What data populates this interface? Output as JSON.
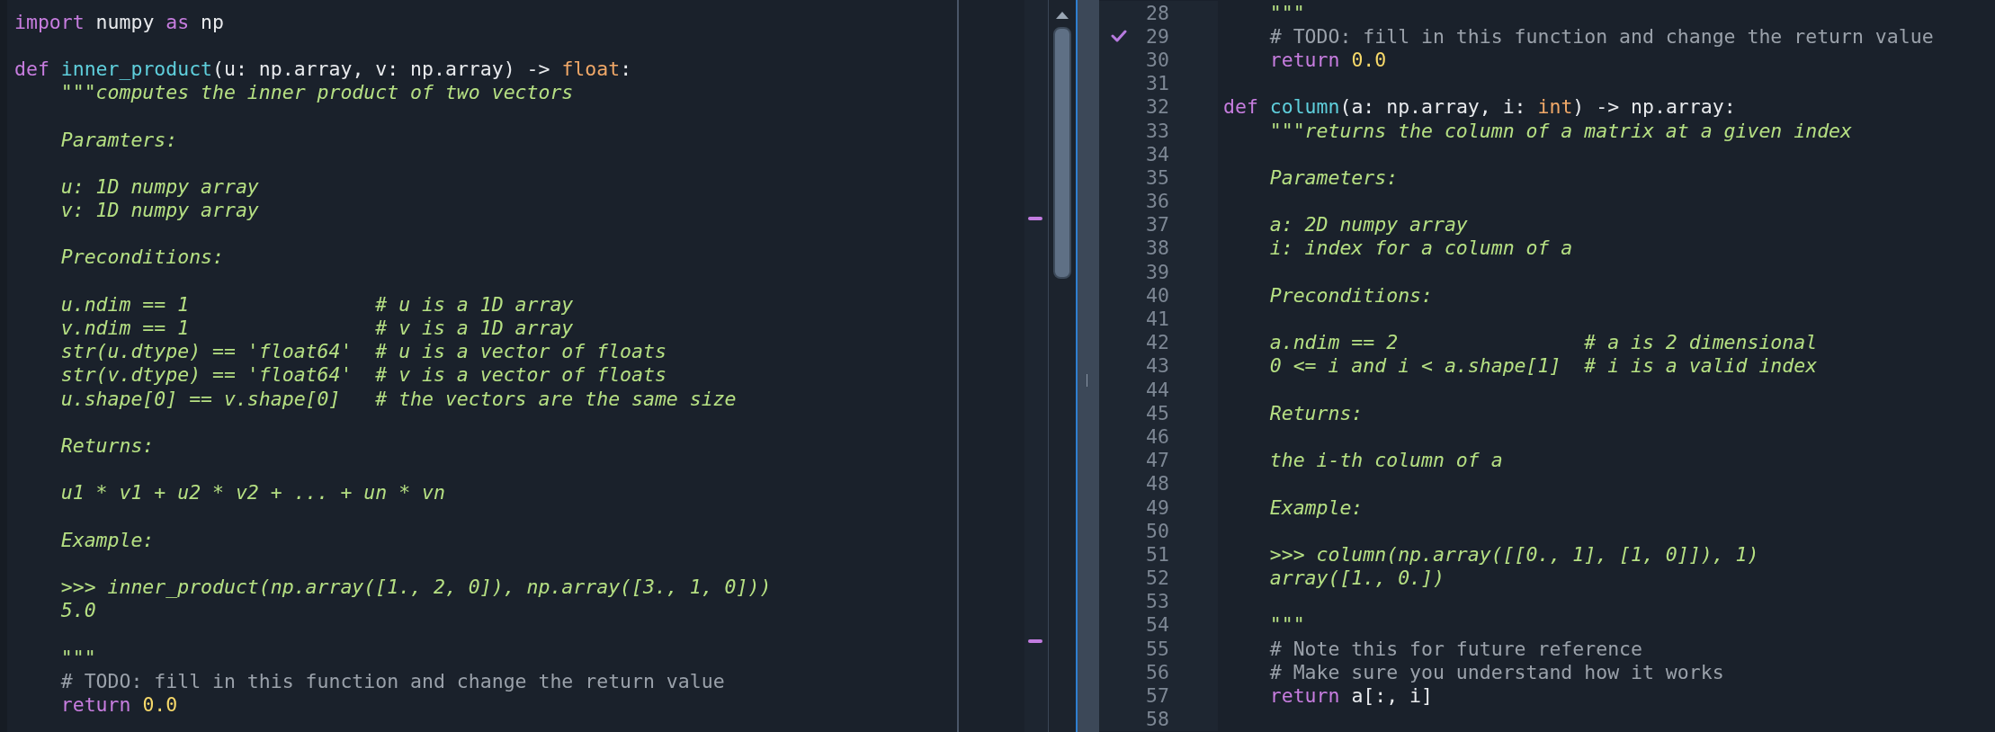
{
  "left_editor": {
    "lines": [
      {
        "kind": "code",
        "segments": [
          {
            "text": "import",
            "kind": "keyword"
          },
          {
            "text": " numpy ",
            "kind": "plain"
          },
          {
            "text": "as",
            "kind": "keyword"
          },
          {
            "text": " np",
            "kind": "plain"
          }
        ]
      },
      {
        "kind": "blank"
      },
      {
        "kind": "code",
        "segments": [
          {
            "text": "def ",
            "kind": "keyword"
          },
          {
            "text": "inner_product",
            "kind": "function"
          },
          {
            "text": "(u: np.array, v: np.array) -> ",
            "kind": "plain"
          },
          {
            "text": "float",
            "kind": "type"
          },
          {
            "text": ":",
            "kind": "plain"
          }
        ]
      },
      {
        "kind": "code",
        "segments": [
          {
            "text": "    \"\"\"computes the inner product of two vectors",
            "kind": "docstring"
          }
        ]
      },
      {
        "kind": "blank"
      },
      {
        "kind": "code",
        "segments": [
          {
            "text": "    Paramters:",
            "kind": "docstring"
          }
        ]
      },
      {
        "kind": "blank"
      },
      {
        "kind": "code",
        "segments": [
          {
            "text": "    u: 1D numpy array",
            "kind": "docstring"
          }
        ]
      },
      {
        "kind": "code",
        "segments": [
          {
            "text": "    v: 1D numpy array",
            "kind": "docstring"
          }
        ]
      },
      {
        "kind": "blank"
      },
      {
        "kind": "code",
        "segments": [
          {
            "text": "    Preconditions:",
            "kind": "docstring"
          }
        ]
      },
      {
        "kind": "blank"
      },
      {
        "kind": "code",
        "segments": [
          {
            "text": "    u.ndim == 1                # u is a 1D array",
            "kind": "docstring"
          }
        ]
      },
      {
        "kind": "code",
        "segments": [
          {
            "text": "    v.ndim == 1                # v is a 1D array",
            "kind": "docstring"
          }
        ]
      },
      {
        "kind": "code",
        "segments": [
          {
            "text": "    str(u.dtype) == 'float64'  # u is a vector of floats",
            "kind": "docstring"
          }
        ]
      },
      {
        "kind": "code",
        "segments": [
          {
            "text": "    str(v.dtype) == 'float64'  # v is a vector of floats",
            "kind": "docstring"
          }
        ]
      },
      {
        "kind": "code",
        "segments": [
          {
            "text": "    u.shape[0] == v.shape[0]   # the vectors are the same size",
            "kind": "docstring"
          }
        ]
      },
      {
        "kind": "blank"
      },
      {
        "kind": "code",
        "segments": [
          {
            "text": "    Returns:",
            "kind": "docstring"
          }
        ]
      },
      {
        "kind": "blank"
      },
      {
        "kind": "code",
        "segments": [
          {
            "text": "    u1 * v1 + u2 * v2 + ... + un * vn",
            "kind": "docstring"
          }
        ]
      },
      {
        "kind": "blank"
      },
      {
        "kind": "code",
        "segments": [
          {
            "text": "    Example:",
            "kind": "docstring"
          }
        ]
      },
      {
        "kind": "blank"
      },
      {
        "kind": "code",
        "segments": [
          {
            "text": "    >>> inner_product(np.array([1., 2, 0]), np.array([3., 1, 0]))",
            "kind": "docstring"
          }
        ]
      },
      {
        "kind": "code",
        "segments": [
          {
            "text": "    5.0",
            "kind": "docstring"
          }
        ]
      },
      {
        "kind": "blank"
      },
      {
        "kind": "code",
        "segments": [
          {
            "text": "    \"\"\"",
            "kind": "docstring"
          }
        ]
      },
      {
        "kind": "code",
        "segments": [
          {
            "text": "    # TODO: fill in this function and change the return value",
            "kind": "comment"
          }
        ]
      },
      {
        "kind": "code",
        "segments": [
          {
            "text": "    return ",
            "kind": "keyword"
          },
          {
            "text": "0.0",
            "kind": "number"
          }
        ]
      }
    ]
  },
  "right_editor": {
    "lines": [
      {
        "number": "28",
        "checked": false,
        "segments": [
          {
            "text": "    \"\"\"",
            "kind": "docstring"
          }
        ]
      },
      {
        "number": "29",
        "checked": true,
        "segments": [
          {
            "text": "    # TODO: fill in this function and change the return value",
            "kind": "comment"
          }
        ]
      },
      {
        "number": "30",
        "checked": false,
        "segments": [
          {
            "text": "    return ",
            "kind": "keyword"
          },
          {
            "text": "0.0",
            "kind": "number"
          }
        ]
      },
      {
        "number": "31",
        "checked": false
      },
      {
        "number": "32",
        "checked": false,
        "segments": [
          {
            "text": "def ",
            "kind": "keyword"
          },
          {
            "text": "column",
            "kind": "function"
          },
          {
            "text": "(a: np.array, i: ",
            "kind": "plain"
          },
          {
            "text": "int",
            "kind": "type"
          },
          {
            "text": ") -> np.array:",
            "kind": "plain"
          }
        ]
      },
      {
        "number": "33",
        "checked": false,
        "segments": [
          {
            "text": "    \"\"\"returns the column of a matrix at a given index",
            "kind": "docstring"
          }
        ]
      },
      {
        "number": "34",
        "checked": false
      },
      {
        "number": "35",
        "checked": false,
        "segments": [
          {
            "text": "    Parameters:",
            "kind": "docstring"
          }
        ]
      },
      {
        "number": "36",
        "checked": false
      },
      {
        "number": "37",
        "checked": false,
        "segments": [
          {
            "text": "    a: 2D numpy array",
            "kind": "docstring"
          }
        ]
      },
      {
        "number": "38",
        "checked": false,
        "segments": [
          {
            "text": "    i: index for a column of a",
            "kind": "docstring"
          }
        ]
      },
      {
        "number": "39",
        "checked": false
      },
      {
        "number": "40",
        "checked": false,
        "segments": [
          {
            "text": "    Preconditions:",
            "kind": "docstring"
          }
        ]
      },
      {
        "number": "41",
        "checked": false
      },
      {
        "number": "42",
        "checked": false,
        "segments": [
          {
            "text": "    a.ndim == 2                # a is 2 dimensional",
            "kind": "docstring"
          }
        ]
      },
      {
        "number": "43",
        "checked": false,
        "segments": [
          {
            "text": "    0 <= i and i < a.shape[1]  # i is a valid index",
            "kind": "docstring"
          }
        ]
      },
      {
        "number": "44",
        "checked": false
      },
      {
        "number": "45",
        "checked": false,
        "segments": [
          {
            "text": "    Returns:",
            "kind": "docstring"
          }
        ]
      },
      {
        "number": "46",
        "checked": false
      },
      {
        "number": "47",
        "checked": false,
        "segments": [
          {
            "text": "    the i-th column of a",
            "kind": "docstring"
          }
        ]
      },
      {
        "number": "48",
        "checked": false
      },
      {
        "number": "49",
        "checked": false,
        "segments": [
          {
            "text": "    Example:",
            "kind": "docstring"
          }
        ]
      },
      {
        "number": "50",
        "checked": false
      },
      {
        "number": "51",
        "checked": false,
        "segments": [
          {
            "text": "    >>> column(np.array([[0., 1], [1, 0]]), 1)",
            "kind": "docstring"
          }
        ]
      },
      {
        "number": "52",
        "checked": false,
        "segments": [
          {
            "text": "    array([1., 0.])",
            "kind": "docstring"
          }
        ]
      },
      {
        "number": "53",
        "checked": false
      },
      {
        "number": "54",
        "checked": false,
        "segments": [
          {
            "text": "    \"\"\"",
            "kind": "docstring"
          }
        ]
      },
      {
        "number": "55",
        "checked": false,
        "segments": [
          {
            "text": "    # Note this for future reference",
            "kind": "comment"
          }
        ]
      },
      {
        "number": "56",
        "checked": false,
        "segments": [
          {
            "text": "    # Make sure you understand how it works",
            "kind": "comment"
          }
        ]
      },
      {
        "number": "57",
        "checked": false,
        "segments": [
          {
            "text": "    return ",
            "kind": "keyword"
          },
          {
            "text": "a[:, i]",
            "kind": "plain"
          }
        ]
      },
      {
        "number": "58",
        "checked": false
      }
    ]
  }
}
